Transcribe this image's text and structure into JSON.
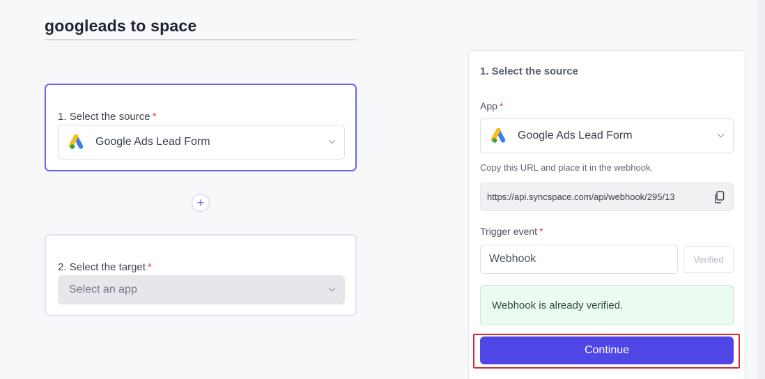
{
  "flow": {
    "title": "googleads to space"
  },
  "steps": [
    {
      "number": "1.",
      "label": "Select the source",
      "required_mark": "*",
      "selected_app": "Google Ads Lead Form",
      "app_icon": "google-ads-icon"
    },
    {
      "number": "2.",
      "label": "Select the target",
      "required_mark": "*",
      "placeholder": "Select an app"
    }
  ],
  "add_step": {
    "symbol": "+"
  },
  "panel": {
    "title": "1. Select the source",
    "app_label": "App",
    "app_required": "*",
    "app_value": "Google Ads Lead Form",
    "url_hint": "Copy this URL and place it in the webhook.",
    "webhook_url": "https://api.syncspace.com/api/webhook/295/13",
    "trigger_label": "Trigger event",
    "trigger_required": "*",
    "trigger_value": "Webhook",
    "verified_label": "Verified",
    "success_message": "Webhook is already verified.",
    "continue_label": "Continue"
  },
  "colors": {
    "accent": "#4f46e5",
    "active_border": "#6b62f5",
    "required": "#e0434b",
    "success_bg": "#ecfbf1",
    "highlight": "#d42a2a"
  }
}
